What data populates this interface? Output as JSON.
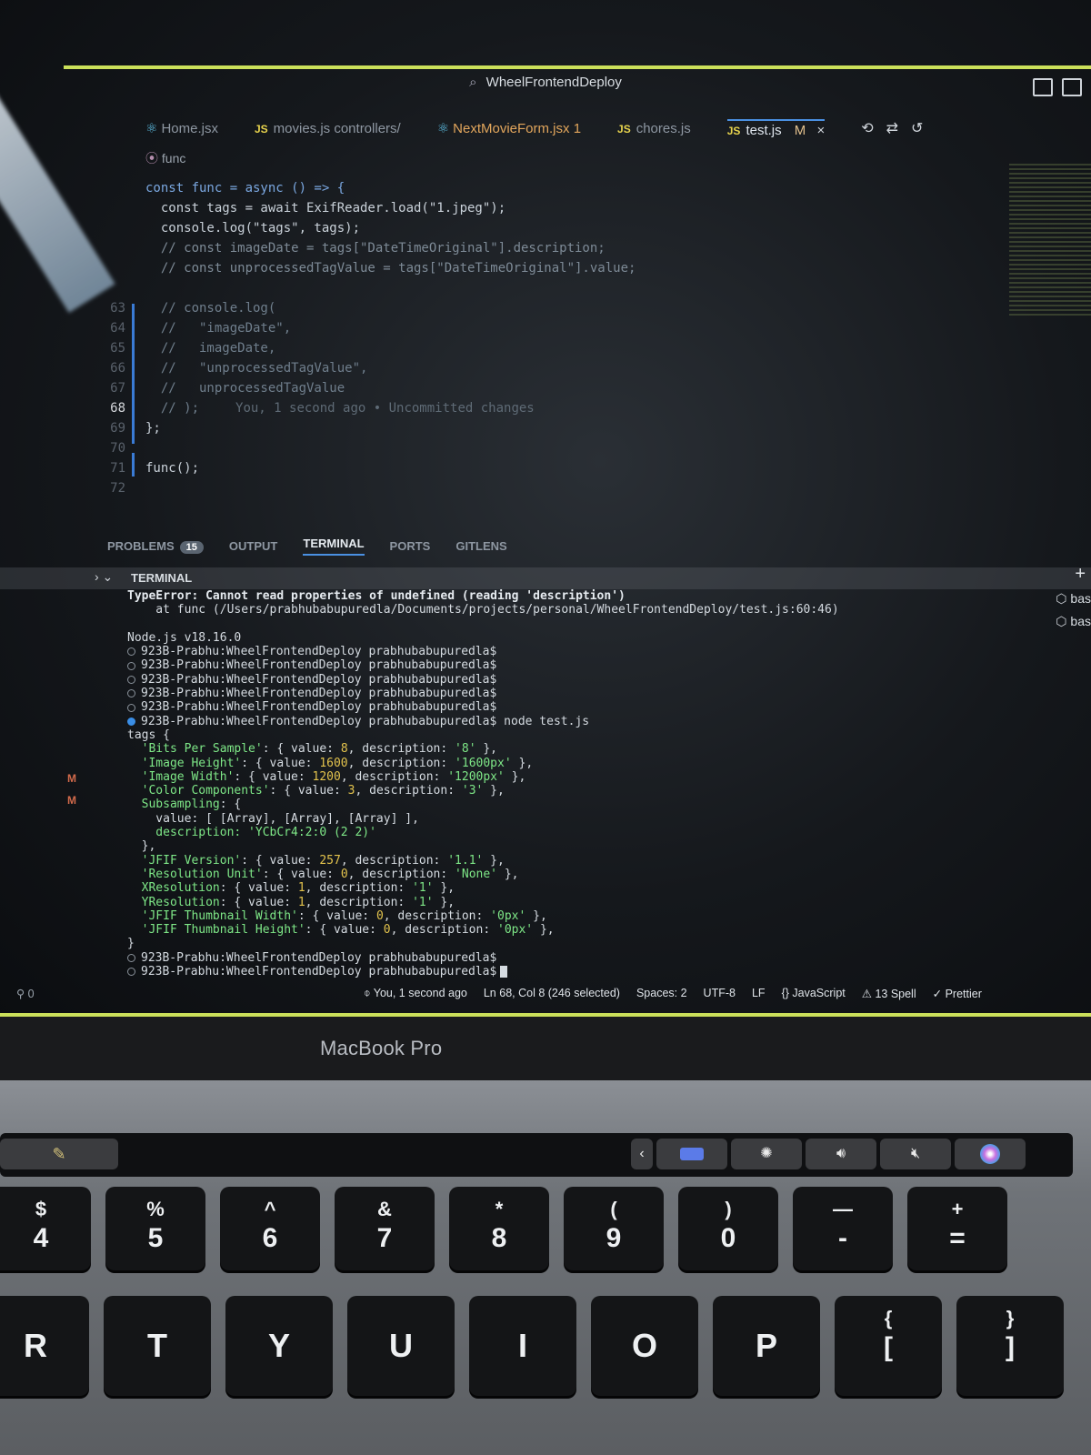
{
  "window": {
    "title": "WheelFrontendDeploy"
  },
  "editor_tabs": [
    {
      "label": "Home.jsx",
      "icon": "react-icon"
    },
    {
      "label": "movies.js controllers/",
      "icon": "js-icon",
      "prefix": "JS"
    },
    {
      "label": "NextMovieForm.jsx",
      "icon": "react-icon",
      "problems": "1"
    },
    {
      "label": "chores.js",
      "icon": "js-icon",
      "prefix": "JS"
    },
    {
      "label": "test.js",
      "icon": "js-icon",
      "prefix": "JS",
      "status": "M",
      "close": "×",
      "active": true
    }
  ],
  "breadcrumb": "func",
  "code_lines": [
    {
      "ln": "",
      "text": "const func = async () => {",
      "style": "kw"
    },
    {
      "ln": "",
      "text": "  const tags = await ExifReader.load(\"1.jpeg\");",
      "style": "code"
    },
    {
      "ln": "",
      "text": "  console.log(\"tags\", tags);",
      "style": "code"
    },
    {
      "ln": "",
      "text": "  // const imageDate = tags[\"DateTimeOriginal\"].description;",
      "style": "dim"
    },
    {
      "ln": "",
      "text": "  // const unprocessedTagValue = tags[\"DateTimeOriginal\"].value;",
      "style": "dim"
    },
    {
      "ln": "",
      "text": "",
      "style": "code"
    },
    {
      "ln": "63",
      "text": "  // console.log(",
      "style": "cmt"
    },
    {
      "ln": "64",
      "text": "  //   \"imageDate\",",
      "style": "cmt"
    },
    {
      "ln": "65",
      "text": "  //   imageDate,",
      "style": "cmt"
    },
    {
      "ln": "66",
      "text": "  //   \"unprocessedTagValue\",",
      "style": "cmt"
    },
    {
      "ln": "67",
      "text": "  //   unprocessedTagValue",
      "style": "cmt"
    },
    {
      "ln": "68",
      "text": "  // );",
      "style": "cmt",
      "blame": "You, 1 second ago • Uncommitted changes",
      "current": true
    },
    {
      "ln": "69",
      "text": "};",
      "style": "code"
    },
    {
      "ln": "70",
      "text": "",
      "style": "code"
    },
    {
      "ln": "71",
      "text": "func();",
      "style": "code"
    },
    {
      "ln": "72",
      "text": "",
      "style": "code"
    }
  ],
  "panel": {
    "tabs": [
      "PROBLEMS",
      "OUTPUT",
      "TERMINAL",
      "PORTS",
      "GITLENS"
    ],
    "problems_count": "15",
    "section_label": "TERMINAL"
  },
  "terminal": {
    "error_line": "TypeError: Cannot read properties of undefined (reading 'description')",
    "error_at": "    at func (/Users/prabhubabupuredla/Documents/projects/personal/WheelFrontendDeploy/test.js:60:46)",
    "node_version": "Node.js v18.16.0",
    "prompt": "923B-Prabhu:WheelFrontendDeploy prabhubabupuredla$",
    "command": "node test.js",
    "tags_open": "tags {",
    "tags_close": "}",
    "subsampling_value": "    value: [ [Array], [Array], [Array] ],",
    "subsampling_desc": "    description: 'YCbCr4:2:0 (2 2)'",
    "subsampling_close": "  },"
  },
  "exif_rows": [
    {
      "key": "'Bits Per Sample'",
      "value": "8",
      "desc": "'8'"
    },
    {
      "key": "'Image Height'",
      "value": "1600",
      "desc": "'1600px'"
    },
    {
      "key": "'Image Width'",
      "value": "1200",
      "desc": "'1200px'"
    },
    {
      "key": "'Color Components'",
      "value": "3",
      "desc": "'3'"
    },
    {
      "key": "'JFIF Version'",
      "value": "257",
      "desc": "'1.1'"
    },
    {
      "key": "'Resolution Unit'",
      "value": "0",
      "desc": "'None'"
    },
    {
      "key": "XResolution",
      "value": "1",
      "desc": "'1'"
    },
    {
      "key": "YResolution",
      "value": "1",
      "desc": "'1'"
    },
    {
      "key": "'JFIF Thumbnail Width'",
      "value": "0",
      "desc": "'0px'"
    },
    {
      "key": "'JFIF Thumbnail Height'",
      "value": "0",
      "desc": "'0px'"
    }
  ],
  "side_terminals": [
    "bas",
    "bas"
  ],
  "statusbar": {
    "ports": "0",
    "blame": "You, 1 second ago",
    "position": "Ln 68, Col 8 (246 selected)",
    "spaces": "Spaces: 2",
    "encoding": "UTF-8",
    "eol": "LF",
    "language": "JavaScript",
    "spell": "13 Spell",
    "prettier": "Prettier"
  },
  "laptop": {
    "brand": "MacBook Pro"
  },
  "keys_row1": [
    {
      "top": "$",
      "bot": "4"
    },
    {
      "top": "%",
      "bot": "5"
    },
    {
      "top": "^",
      "bot": "6"
    },
    {
      "top": "&",
      "bot": "7"
    },
    {
      "top": "*",
      "bot": "8"
    },
    {
      "top": "(",
      "bot": "9"
    },
    {
      "top": ")",
      "bot": "0"
    },
    {
      "top": "—",
      "bot": "-"
    },
    {
      "top": "+",
      "bot": "="
    }
  ],
  "keys_row2": [
    {
      "top": "",
      "bot": "R"
    },
    {
      "top": "",
      "bot": "T"
    },
    {
      "top": "",
      "bot": "Y"
    },
    {
      "top": "",
      "bot": "U"
    },
    {
      "top": "",
      "bot": "I"
    },
    {
      "top": "",
      "bot": "O"
    },
    {
      "top": "",
      "bot": "P"
    },
    {
      "top": "{",
      "bot": "["
    },
    {
      "top": "}",
      "bot": "]"
    }
  ],
  "colors": {
    "accent": "#cbe05a",
    "focus": "#4a90e2"
  }
}
